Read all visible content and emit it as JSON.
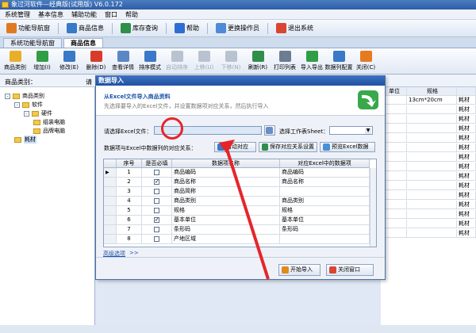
{
  "window": {
    "title": "象过河软件—经典版(试用版) V6.0.172"
  },
  "menu": [
    "系统管理",
    "基本信息",
    "辅助功能",
    "窗口",
    "帮助"
  ],
  "topbar": {
    "items": [
      {
        "label": "功能导航窗",
        "icon": "home-icon",
        "color": "#e07a21"
      },
      {
        "label": "商品信息",
        "icon": "grid-icon",
        "color": "#3a78c8"
      },
      {
        "label": "库存查询",
        "icon": "table-icon",
        "color": "#2f8f4a"
      },
      {
        "label": "帮助",
        "icon": "help-icon",
        "color": "#2e6ed2"
      },
      {
        "label": "更换操作员",
        "icon": "users-icon",
        "color": "#4f8ad8"
      },
      {
        "label": "退出系统",
        "icon": "exit-icon",
        "color": "#d9452f"
      }
    ]
  },
  "tabs": [
    "系统功能导航窗",
    "商品信息"
  ],
  "toolbar": {
    "items": [
      {
        "label": "商品类别",
        "icon": "folder-icon",
        "color": "#e8b02a",
        "disabled": false
      },
      {
        "label": "增加(I)",
        "icon": "add-icon",
        "color": "#2f9e44",
        "disabled": false
      },
      {
        "label": "修改(E)",
        "icon": "edit-icon",
        "color": "#3a78c8",
        "disabled": false
      },
      {
        "label": "删除(D)",
        "icon": "delete-icon",
        "color": "#d93b2b",
        "disabled": false
      },
      {
        "label": "查看详情",
        "icon": "details-icon",
        "color": "#5b87c5",
        "disabled": false
      },
      {
        "label": "排序模式",
        "icon": "sort-icon",
        "color": "#3a78c8",
        "disabled": false
      },
      {
        "label": "自动排序",
        "icon": "auto-sort-icon",
        "color": "#b9c3cf",
        "disabled": true
      },
      {
        "label": "上移(U)",
        "icon": "up-icon",
        "color": "#b9c3cf",
        "disabled": true
      },
      {
        "label": "下移(N)",
        "icon": "down-icon",
        "color": "#b9c3cf",
        "disabled": true
      },
      {
        "label": "刷新(R)",
        "icon": "refresh-icon",
        "color": "#2f8f4a",
        "disabled": false
      },
      {
        "label": "打印列表",
        "icon": "print-icon",
        "color": "#6b7c93",
        "disabled": false
      },
      {
        "label": "导入导出",
        "icon": "import-export-icon",
        "color": "#2f9e44",
        "disabled": false
      },
      {
        "label": "数据列配置",
        "icon": "config-icon",
        "color": "#3a78c8",
        "disabled": false
      },
      {
        "label": "关闭(C)",
        "icon": "close-icon",
        "color": "#e67a1f",
        "disabled": false
      }
    ]
  },
  "category_label": "商品类别：",
  "category_label_right": "请",
  "tree": [
    {
      "label": "商品类别",
      "level": 0,
      "toggle": "-"
    },
    {
      "label": "软件",
      "level": 1,
      "toggle": "-"
    },
    {
      "label": "硬件",
      "level": 2,
      "toggle": "-"
    },
    {
      "label": "组装电脑",
      "level": 3,
      "toggle": ""
    },
    {
      "label": "品牌电脑",
      "level": 3,
      "toggle": ""
    },
    {
      "label": "耗材",
      "level": 1,
      "toggle": "",
      "selected": true
    }
  ],
  "grid_right": {
    "headers": [
      "单位",
      "规格",
      ""
    ],
    "rows": [
      [
        "",
        "13cm*20cm",
        "耗材"
      ],
      [
        "",
        "",
        "耗材"
      ],
      [
        "",
        "",
        "耗材"
      ],
      [
        "",
        "",
        "耗材"
      ],
      [
        "",
        "",
        "耗材"
      ],
      [
        "",
        "",
        "耗材"
      ],
      [
        "",
        "",
        "耗材"
      ],
      [
        "",
        "",
        "耗材"
      ],
      [
        "",
        "",
        "耗材"
      ],
      [
        "",
        "",
        "耗材"
      ],
      [
        "",
        "",
        "耗材"
      ],
      [
        "",
        "",
        "耗材"
      ],
      [
        "",
        "",
        "耗材"
      ],
      [
        "",
        "",
        "耗材"
      ],
      [
        "",
        "",
        "耗材"
      ]
    ]
  },
  "dialog": {
    "title": "数据导入",
    "heading": "从Excel文件导入商品资料",
    "subheading": "先选择要导入的Excel文件，并设置数据项对应关系，然后执行导入",
    "file_label": "请选择Excel文件：",
    "file_value": "",
    "sheet_label": "选择工作表Sheet：",
    "sheet_value": "",
    "mapping_label": "数据项与Excel中数据列的对应关系：",
    "btn_auto": "自动对应",
    "btn_save": "保存对应关系设置",
    "btn_preview": "预览Excel数据",
    "table_headers": [
      "序号",
      "是否必填",
      "数据项名称",
      "对应Excel中的数据项"
    ],
    "rows": [
      {
        "no": "1",
        "required": false,
        "name": "商品编码",
        "excel": "商品编码"
      },
      {
        "no": "2",
        "required": true,
        "name": "商品名称",
        "excel": "商品名称"
      },
      {
        "no": "3",
        "required": false,
        "name": "商品简称",
        "excel": ""
      },
      {
        "no": "4",
        "required": false,
        "name": "商品类别",
        "excel": "商品类别"
      },
      {
        "no": "5",
        "required": false,
        "name": "规格",
        "excel": "规格"
      },
      {
        "no": "6",
        "required": true,
        "name": "基本单位",
        "excel": "基本单位"
      },
      {
        "no": "7",
        "required": false,
        "name": "条形码",
        "excel": "条形码"
      },
      {
        "no": "8",
        "required": false,
        "name": "产地区域",
        "excel": ""
      }
    ],
    "advanced_link": "高级选项",
    "advanced_arrows": ">>",
    "btn_start": "开始导入",
    "btn_close": "关闭窗口"
  }
}
